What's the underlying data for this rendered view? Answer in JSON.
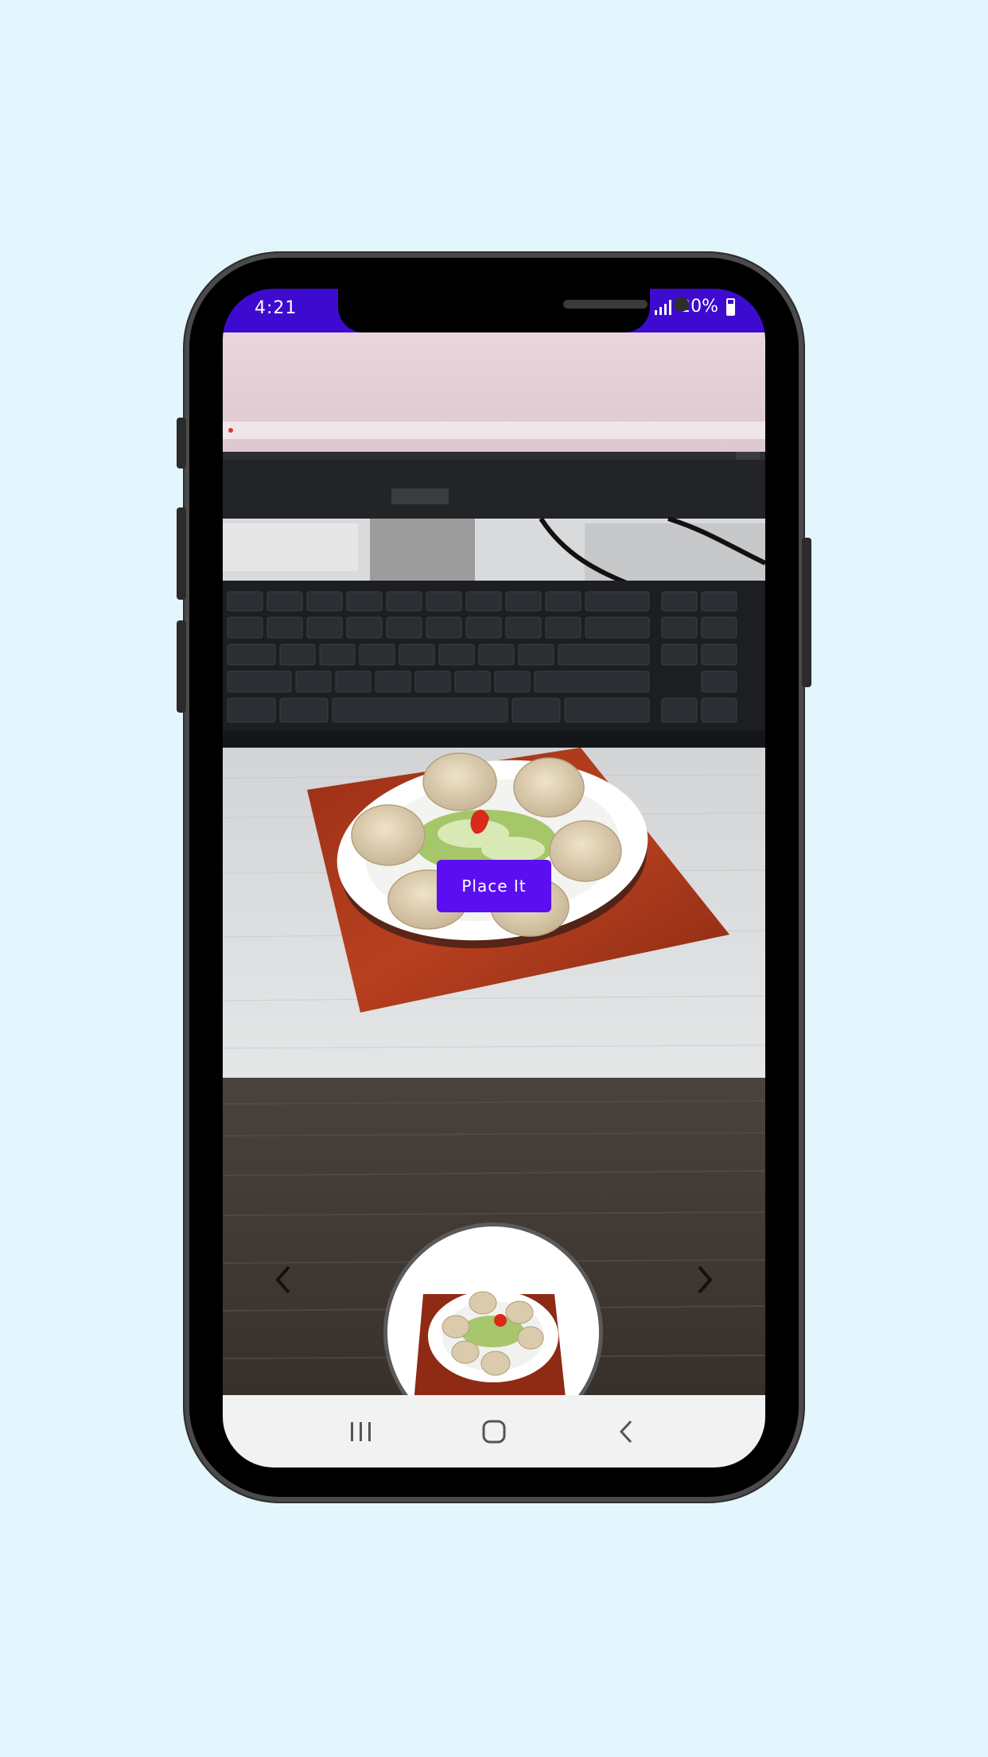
{
  "status_bar": {
    "time": "4:21",
    "battery_text": "20%",
    "color": "#3d0bd0"
  },
  "ar_view": {
    "place_button_label": "Place It",
    "place_button_color": "#5b0ff0",
    "prev_icon": "chevron-left-icon",
    "next_icon": "chevron-right-icon",
    "model_preview": "momo-plate-thumbnail"
  },
  "system_nav": {
    "recents_icon": "recents-icon",
    "home_icon": "home-icon",
    "back_icon": "back-icon"
  },
  "background": {
    "color": "#e3f6fe"
  }
}
